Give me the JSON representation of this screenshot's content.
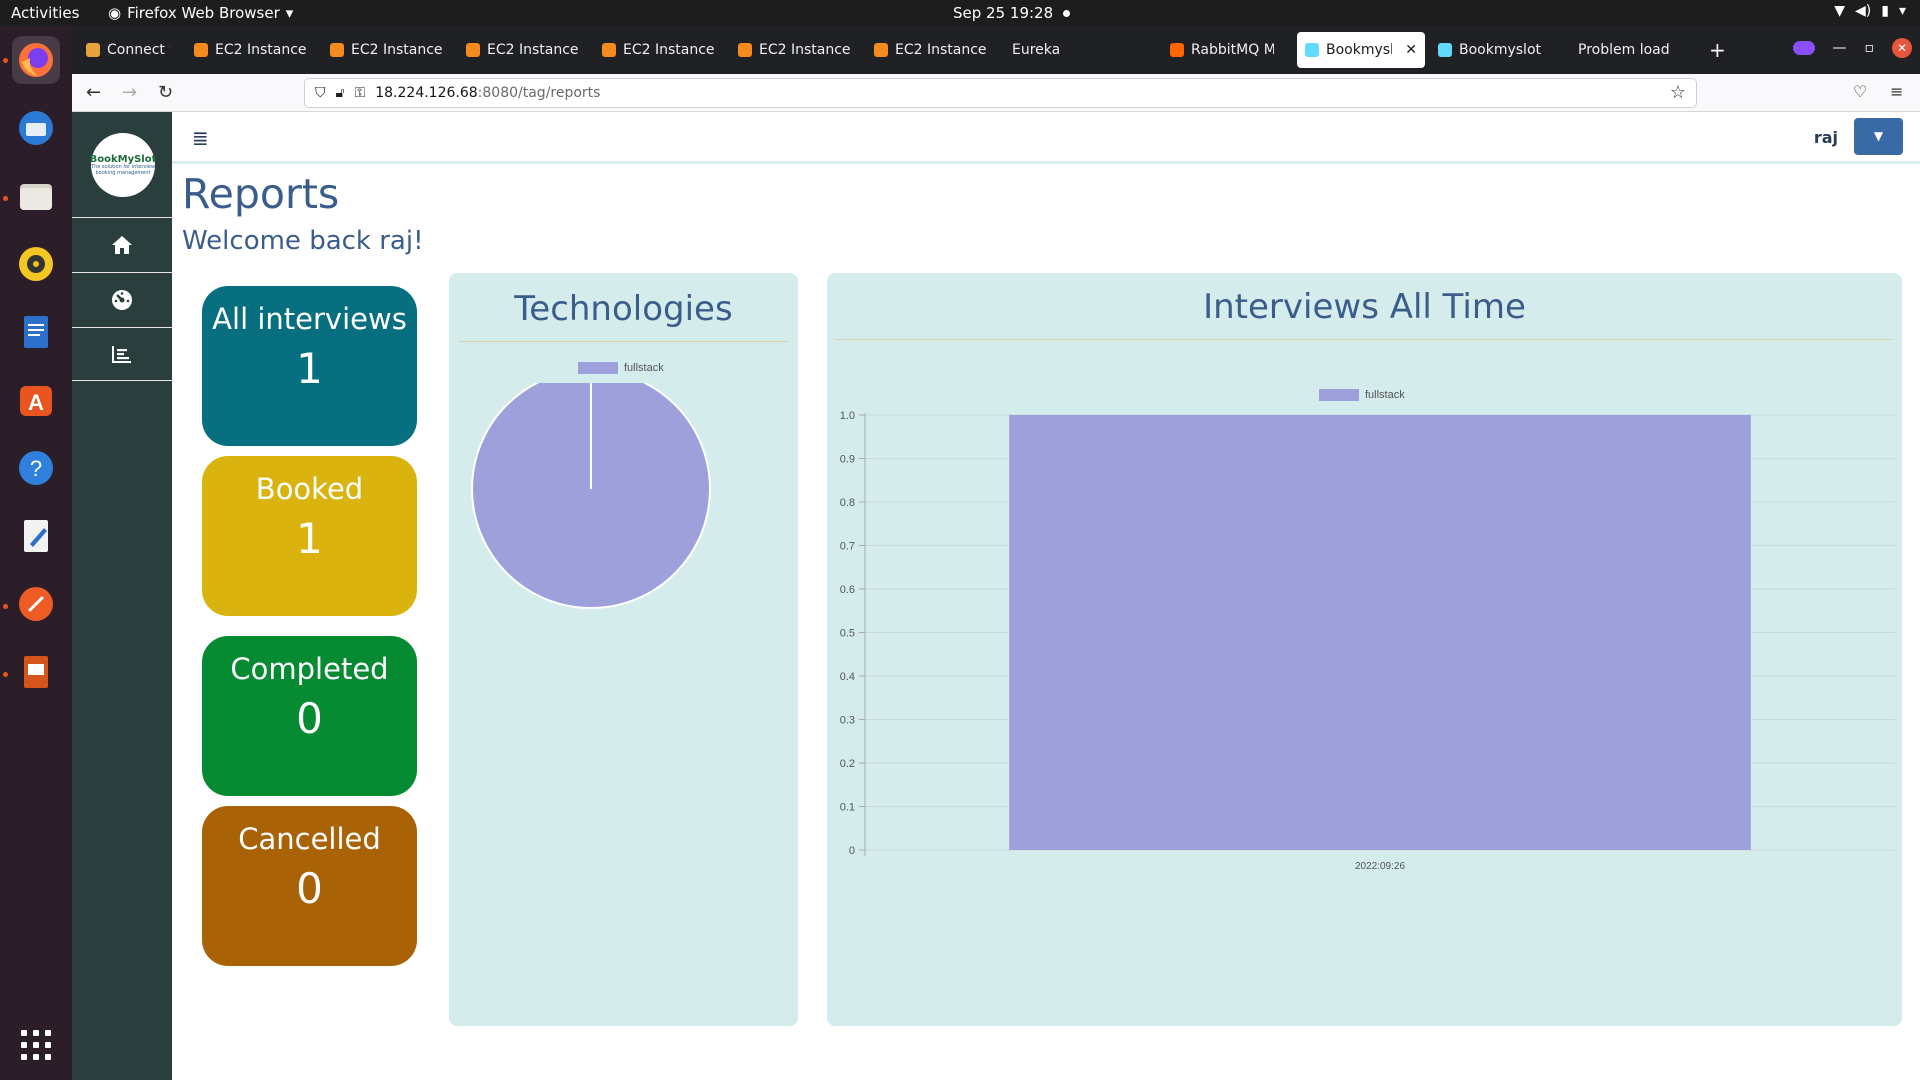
{
  "system": {
    "activities": "Activities",
    "app_name": "Firefox Web Browser",
    "clock": "Sep 25  19:28"
  },
  "browser": {
    "tabs": [
      {
        "label": "Connect to ins",
        "fav": "#e8a33b"
      },
      {
        "label": "EC2 Instance",
        "fav": "#f58a1f"
      },
      {
        "label": "EC2 Instance",
        "fav": "#f58a1f"
      },
      {
        "label": "EC2 Instance",
        "fav": "#f58a1f"
      },
      {
        "label": "EC2 Instance",
        "fav": "#f58a1f"
      },
      {
        "label": "EC2 Instance",
        "fav": "#f58a1f"
      },
      {
        "label": "EC2 Instance",
        "fav": "#f58a1f"
      },
      {
        "label": "Eureka",
        "fav": ""
      },
      {
        "label": "RabbitMQ Ma",
        "fav": "#ff6600"
      },
      {
        "label": "Bookmyslot",
        "fav": "#61dafb",
        "active": true
      },
      {
        "label": "Bookmyslot",
        "fav": "#61dafb"
      },
      {
        "label": "Problem load",
        "fav": ""
      }
    ],
    "url_host": "18.224.126.68",
    "url_path": ":8080/tag/reports"
  },
  "app": {
    "logo_text": "BookMySlot",
    "logo_tagline": "The solution for interview booking management",
    "user": "raj",
    "nav_icons": [
      "home-icon",
      "dashboard-icon",
      "chart-icon"
    ],
    "title": "Reports",
    "welcome": "Welcome back raj!"
  },
  "stats": [
    {
      "label": "All interviews",
      "value": "1",
      "color": "#076f80"
    },
    {
      "label": "Booked",
      "value": "1",
      "color": "#dab30f"
    },
    {
      "label": "Completed",
      "value": "0",
      "color": "#068b33"
    },
    {
      "label": "Cancelled",
      "value": "0",
      "color": "#a96205"
    }
  ],
  "chart_data": [
    {
      "type": "pie",
      "title": "Technologies",
      "categories": [
        "fullstack"
      ],
      "values": [
        1
      ],
      "colors": [
        "#9da0db"
      ],
      "legend": "top"
    },
    {
      "type": "bar",
      "title": "Interviews All Time",
      "categories": [
        "2022:09:26"
      ],
      "series": [
        {
          "name": "fullstack",
          "values": [
            1
          ],
          "color": "#9da0db"
        }
      ],
      "ylim": [
        0,
        1
      ],
      "yticks": [
        "0",
        "0.1",
        "0.2",
        "0.3",
        "0.4",
        "0.5",
        "0.6",
        "0.7",
        "0.8",
        "0.9",
        "1.0"
      ],
      "grid": true,
      "legend": "top"
    }
  ]
}
